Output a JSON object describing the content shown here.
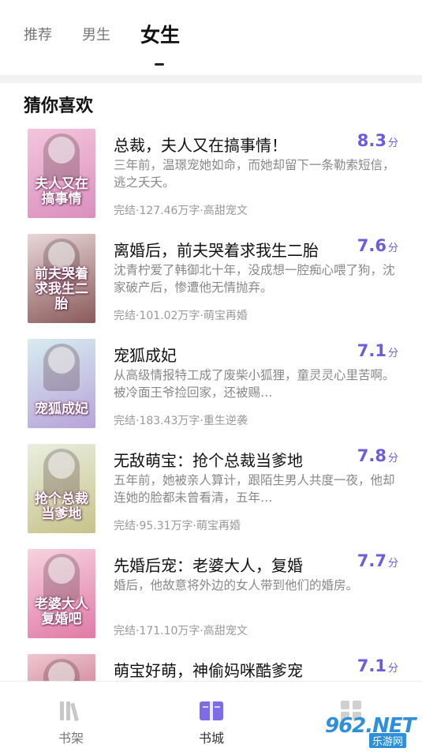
{
  "tabs": [
    {
      "label": "推荐",
      "active": false
    },
    {
      "label": "男生",
      "active": false
    },
    {
      "label": "女生",
      "active": true
    }
  ],
  "section": {
    "title": "猜你喜欢"
  },
  "score_unit": "分",
  "books": [
    {
      "title": "总裁，夫人又在搞事情！",
      "score": "8.3",
      "desc": "三年前，温璟宠她如命，而她却留下一条勒索短信，逃之夭夭。",
      "meta": "完结·127.46万字·高甜宠文",
      "cover_text": "夫人又在搞事情",
      "cover_colors": [
        "#f3c6dc",
        "#d98fbd"
      ]
    },
    {
      "title": "离婚后，前夫哭着求我生二胎",
      "score": "7.6",
      "desc": "沈青柠爱了韩御北十年，没成想一腔痴心喂了狗，沈家破产后，惨遭他无情抛弃。",
      "meta": "完结·101.02万字·萌宝再婚",
      "cover_text": "前夫哭着求我生二胎",
      "cover_colors": [
        "#e8d7d7",
        "#8a5a5a"
      ]
    },
    {
      "title": "宠狐成妃",
      "score": "7.1",
      "desc": "从高级情报特工成了废柴小狐狸，童灵灵心里苦啊。被冷面王爷捡回家，还被赐…",
      "meta": "完结·183.43万字·重生逆袭",
      "cover_text": "宠狐成妃",
      "cover_colors": [
        "#d8ecf0",
        "#b7a3d9"
      ]
    },
    {
      "title": "无敌萌宝：抢个总裁当爹地",
      "score": "7.8",
      "desc": "五年前，她被亲人算计，跟陌生男人共度一夜，他却连她的脸都未曾看清，五年…",
      "meta": "完结·95.31万字·萌宝再婚",
      "cover_text": "抢个总裁当爹地",
      "cover_colors": [
        "#e9efe0",
        "#c7c28a"
      ]
    },
    {
      "title": "先婚后宠：老婆大人，复婚",
      "score": "7.7",
      "desc": "婚后，他故意将外边的女人带到他们的婚房。",
      "meta": "完结·171.10万字·高甜宠文",
      "cover_text": "老婆大人复婚吧",
      "cover_colors": [
        "#f6d3df",
        "#e07aa6"
      ]
    },
    {
      "title": "萌宝好萌，神偷妈咪酷爹宠",
      "score": "7.1",
      "desc": "",
      "meta": "",
      "cover_text": "",
      "cover_colors": [
        "#f0c6cf",
        "#b75a77"
      ]
    }
  ],
  "bottom_nav": [
    {
      "label": "书架",
      "icon": "bookshelf-icon",
      "active": false
    },
    {
      "label": "书城",
      "icon": "book-open-icon",
      "active": true
    },
    {
      "label": "",
      "icon": "grid-icon",
      "active": false
    }
  ],
  "watermark": {
    "main": "962.NET",
    "sub": "乐游网"
  },
  "colors": {
    "accent": "#6b5ddb",
    "meta": "#999999",
    "desc": "#888888"
  }
}
